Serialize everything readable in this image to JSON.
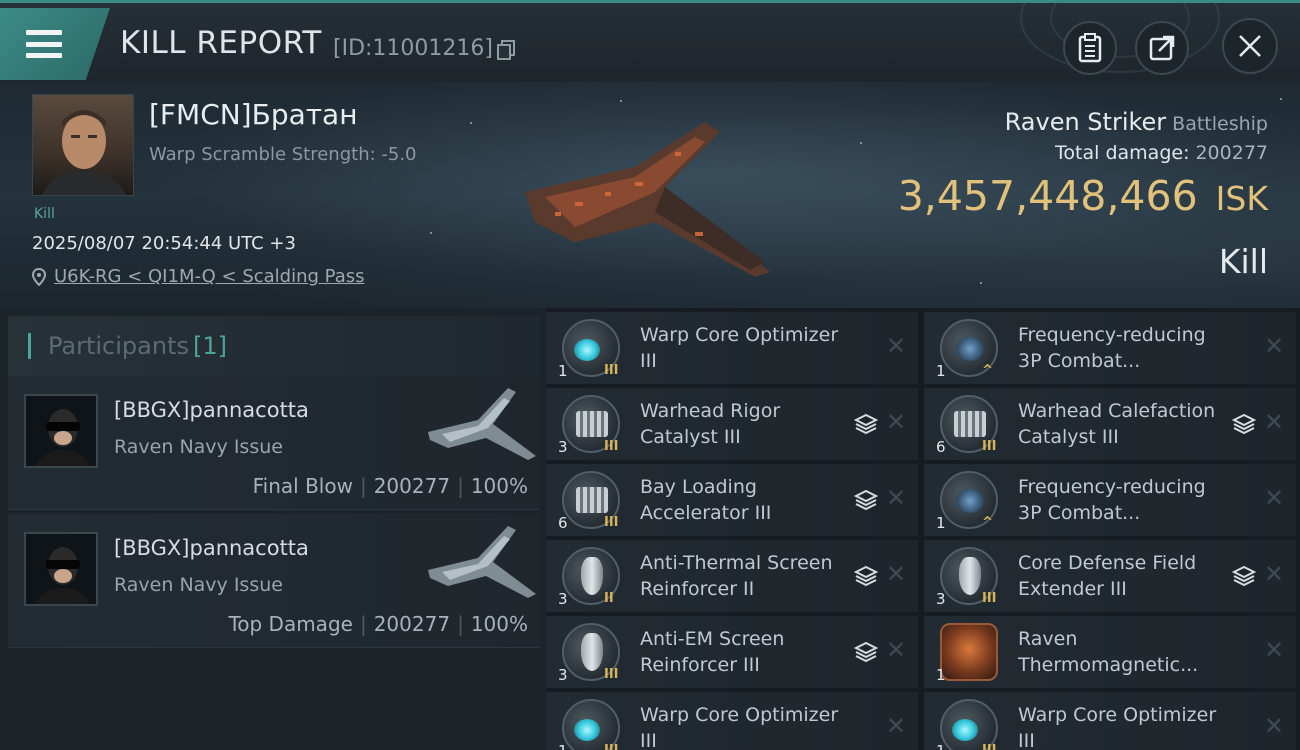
{
  "header": {
    "title": "KILL REPORT",
    "report_id": "[ID:11001216]"
  },
  "victim": {
    "name": "[FMCN]Братан",
    "warp_scramble": "Warp Scramble Strength: -5.0",
    "tag": "Kill",
    "datetime": "2025/08/07 20:54:44 UTC +3",
    "location": "U6K-RG < QI1M-Q < Scalding Pass",
    "ship_name": "Raven Striker",
    "ship_class": "Battleship",
    "total_damage_label": "Total damage:",
    "total_damage": "200277",
    "isk_value": "3,457,448,466",
    "isk_unit": "ISK",
    "result": "Kill",
    "accent_color": "#e2c27a"
  },
  "participants": {
    "title": "Participants",
    "count": "[1]",
    "list": [
      {
        "name": "[BBGX]pannacotta",
        "ship": "Raven Navy Issue",
        "role": "Final Blow",
        "damage": "200277",
        "percent": "100%"
      },
      {
        "name": "[BBGX]pannacotta",
        "ship": "Raven Navy Issue",
        "role": "Top Damage",
        "damage": "200277",
        "percent": "100%"
      }
    ]
  },
  "modules": {
    "left": [
      {
        "name": "Warp Core Optimizer III",
        "qty": "1",
        "tier": "III",
        "icon": "cyan",
        "stack": false
      },
      {
        "name": "Warhead Rigor Catalyst III",
        "qty": "3",
        "tier": "III",
        "icon": "rack",
        "stack": true
      },
      {
        "name": "Bay Loading Accelerator III",
        "qty": "6",
        "tier": "III",
        "icon": "rack",
        "stack": true
      },
      {
        "name": "Anti-Thermal Screen Reinforcer II",
        "qty": "3",
        "tier": "II",
        "icon": "shield",
        "stack": true
      },
      {
        "name": "Anti-EM Screen Reinforcer III",
        "qty": "3",
        "tier": "III",
        "icon": "shield",
        "stack": true
      },
      {
        "name": "Warp Core Optimizer III",
        "qty": "1",
        "tier": "III",
        "icon": "cyan",
        "stack": false
      }
    ],
    "right": [
      {
        "name": "Frequency-reducing 3P Combat...",
        "qty": "1",
        "tier": "^",
        "icon": "lens",
        "stack": false
      },
      {
        "name": "Warhead Calefaction Catalyst III",
        "qty": "6",
        "tier": "III",
        "icon": "rack",
        "stack": true
      },
      {
        "name": "Frequency-reducing 3P Combat...",
        "qty": "1",
        "tier": "^",
        "icon": "lens",
        "stack": false
      },
      {
        "name": "Core Defense Field Extender III",
        "qty": "3",
        "tier": "III",
        "icon": "shield",
        "stack": true
      },
      {
        "name": "Raven Thermomagnetic...",
        "qty": "1",
        "tier": "",
        "icon": "rig",
        "stack": false
      },
      {
        "name": "Warp Core Optimizer III",
        "qty": "1",
        "tier": "III",
        "icon": "cyan",
        "stack": false
      }
    ]
  }
}
